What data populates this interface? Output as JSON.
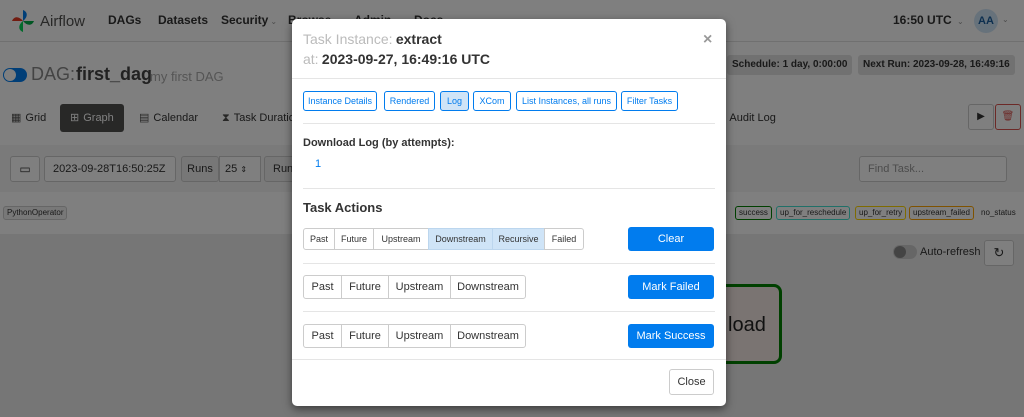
{
  "navbar": {
    "brand": "Airflow",
    "items": [
      {
        "label": "DAGs",
        "caret": ""
      },
      {
        "label": "Datasets",
        "caret": ""
      },
      {
        "label": "Security",
        "caret": "⌄"
      },
      {
        "label": "Browse",
        "caret": "⌄"
      },
      {
        "label": "Admin",
        "caret": "⌄"
      },
      {
        "label": "Docs",
        "caret": "⌄"
      }
    ],
    "time": "16:50 UTC",
    "avatar": "AA"
  },
  "dag": {
    "label": "DAG:",
    "id": "first_dag",
    "description": "my first DAG",
    "schedule": "Schedule: 1 day, 0:00:00",
    "next_run": "Next Run: 2023-09-28, 16:49:16"
  },
  "tabs": [
    {
      "label": "Grid",
      "icon": "grid-icon"
    },
    {
      "label": "Graph",
      "icon": "graph-icon"
    },
    {
      "label": "Calendar",
      "icon": "calendar-icon"
    },
    {
      "label": "Task Duration",
      "icon": "hourglass-icon"
    },
    {
      "label": "Audit Log",
      "icon": "audit-log-icon"
    }
  ],
  "filter": {
    "date": "2023-09-28T16:50:25Z",
    "runs_label": "Runs",
    "runs_value": "25",
    "run_label": "Run",
    "find_placeholder": "Find Task..."
  },
  "legend": {
    "operator": "PythonOperator",
    "states": [
      {
        "label": "success",
        "color": "#008000"
      },
      {
        "label": "up_for_reschedule",
        "color": "#40e0d0"
      },
      {
        "label": "up_for_retry",
        "color": "#ffd700"
      },
      {
        "label": "upstream_failed",
        "color": "#ffa500"
      },
      {
        "label": "no_status",
        "color": "#ffffff"
      }
    ]
  },
  "graph": {
    "auto_refresh": "Auto-refresh",
    "node_label": "load"
  },
  "modal": {
    "task_label": "Task Instance:",
    "task_id": "extract",
    "at_label": "at:",
    "at_value": "2023-09-27, 16:49:16 UTC",
    "pills": [
      "Instance Details",
      "Rendered",
      "Log",
      "XCom",
      "List Instances, all runs",
      "Filter Tasks"
    ],
    "active_pill": "Log",
    "download_label": "Download Log (by attempts):",
    "attempt": "1",
    "actions_title": "Task Actions",
    "clear_options": [
      "Past",
      "Future",
      "Upstream",
      "Downstream",
      "Recursive",
      "Failed"
    ],
    "clear_button": "Clear",
    "mark_failed_options": [
      "Past",
      "Future",
      "Upstream",
      "Downstream"
    ],
    "mark_failed_button": "Mark Failed",
    "mark_success_options": [
      "Past",
      "Future",
      "Upstream",
      "Downstream"
    ],
    "mark_success_button": "Mark Success",
    "close_button": "Close"
  },
  "colors": {
    "primary": "#017cee",
    "active_tab": "#51504f",
    "success_border": "#008000"
  }
}
